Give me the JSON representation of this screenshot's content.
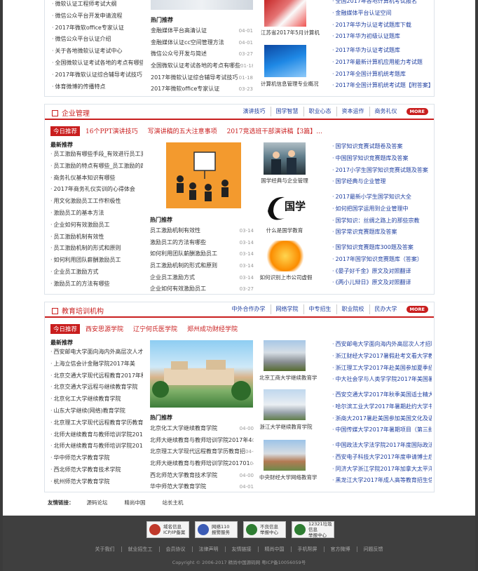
{
  "top": {
    "left_list": [
      "微软认证工程师考试大纲",
      "微信公众平台开发申请流程",
      "2017年微软office专家认证",
      "微信公众平台认证介绍",
      "关于各地微软认证考试中心",
      "全国微软认证考试各地的考点有哪些",
      "2017年微软认证综合辅导考试技巧",
      "体育微博的传播特点"
    ],
    "hot_title": "热门推荐",
    "hot": [
      [
        "金融媒体平台高清认证",
        "04-01"
      ],
      [
        "金融媒体认证cc空间管理方法",
        "04-01"
      ],
      [
        "微信公众号开发与简述",
        "03-27"
      ],
      [
        "全国微软认证考试各地的考点有哪些",
        "01-18"
      ],
      [
        "2017年微软认证综合辅导考试技巧",
        "01-18"
      ],
      [
        "2017年微软office专家认证",
        "03-23"
      ]
    ],
    "cap1": "江苏省2017年5月计算机",
    "cap2": "计算机信息管理专业概况",
    "right1": [
      "全国2017年各地计算机考试报名",
      "金融媒体平台认证空间",
      "2017年华为认证考试题库下载",
      "2017年华为初级认证题库"
    ],
    "right2": [
      "2017年华为认证考试题库",
      "2017年最新计算机应用能力考试题",
      "2017年全国计算机统考题库",
      "2017年全国计算机统考试题【附答案】"
    ]
  },
  "s1": {
    "name": "企业管理",
    "tabs": [
      "演讲技巧",
      "国学智慧",
      "职业心态",
      "资本运作",
      "商务礼仪"
    ],
    "more": "MORE",
    "today_tag": "今日推荐",
    "today": [
      "16个PPT演讲技巧",
      "写演讲稿的五大注意事项",
      "2017竞选班干部演讲稿【3篇】..."
    ],
    "new_title": "最新推荐",
    "list": [
      "员工激励有哪些手段_有效进行员工激",
      "员工激励的特点有哪些_员工激励的四",
      "商务礼仪基本知识有哪些",
      "2017年商务礼仪实训的心得体会",
      "用文化激励员工工作积极性",
      "激励员工的基本方法",
      "企业如何有效激励员工",
      "员工激励机制有效性",
      "员工激励机制的形式和原则",
      "如何利用团队薪酬激励员工",
      "企业员工激励方式",
      "激励员工的方法有哪些"
    ],
    "hot_title": "热门推荐",
    "hot": [
      [
        "员工激励机制有效性",
        "03-14"
      ],
      [
        "激励员工的方法有哪些",
        "03-14"
      ],
      [
        "如何利用团队薪酬激励员工",
        "03-14"
      ],
      [
        "员工激励机制的形式和原则",
        "03-14"
      ],
      [
        "企业员工激励方式",
        "03-14"
      ],
      [
        "企业如何有效激励员工",
        "03-27"
      ]
    ],
    "cap1": "国学经典与企业管理",
    "cap2": "什么是国学教育",
    "guoxue": "国学",
    "cap3": "如何识别上市公司虚假",
    "r1": [
      "国学知识竞赛试题卷及答案",
      "中国国学知识竞赛题库及答案",
      "2017小学生国学知识竞赛试题及答案",
      "国学经典与企业管理"
    ],
    "r2": [
      "2017最新小学生国学知识大全",
      "如何把国学运用到企业管理中",
      "国学知识：丝绸之路上的那些宗教",
      "国学常识竞赛题库及答案"
    ],
    "r3": [
      "国学知识竞赛题库300题及答案",
      "2017年国学知识竞赛题库（答案）",
      "《晏子好千金》原文及对照翻译",
      "《两小儿辩日》原文及对照翻译"
    ]
  },
  "s2": {
    "name": "教育培训机构",
    "tabs": [
      "中外合作办学",
      "网络学院",
      "中专招生",
      "职业院校",
      "民办大学"
    ],
    "more": "MORE",
    "today_tag": "今日推荐",
    "today": [
      "西安思源学院",
      "辽宁何氏医学院",
      "郑州成功财经学院"
    ],
    "new_title": "最新推荐",
    "list": [
      "西安邮电大学面向海内外高层次人才招",
      "上海立信会计金融学院2017年美",
      "北京交通大学现代远程教育2017年秋季",
      "北京交通大学远程与继续教育学院",
      "北京化工大学继续教育学院",
      "山东大学继续(网络)教育学院",
      "北京理工大学现代远程教育学历教育招",
      "北师大继续教育与教师培训学院201701",
      "北师大继续教育与教师培训学院2017年",
      "华中师范大学教育学院",
      "西北师范大学教育技术学院",
      "杭州师范大学教育学院"
    ],
    "hot_title": "热门推荐",
    "hot": [
      [
        "北京化工大学继续教育学院",
        "04-00"
      ],
      [
        "北师大继续教育与教师培训学院2017年4",
        "04-00"
      ],
      [
        "北京理工大学现代远程教育学历教育招",
        "04-00"
      ],
      [
        "北师大继续教育与教师培训学院201701",
        "04-00"
      ],
      [
        "西北师范大学教育技术学院",
        "04-00"
      ],
      [
        "华中师范大学教育学院",
        "04-01"
      ]
    ],
    "cap1": "北京工商大学继续教育学",
    "cap2": "浙江大学继续教育学院",
    "cap3": "中央财经大学网络教育学",
    "r1": [
      "西安邮电大学面向海内外高层次人才招聘",
      "浙江财经大学2017暑假赴考文看大学教",
      "浙江理工大学2017年赴美国参加夏季招",
      "中大社会学与人类学学院2017年美国暑期游"
    ],
    "r2": [
      "西安交通大学2017年秋季美国适士精大学",
      "哈尔滨工业大学2017年暑期赴约大学书",
      "浙商大2017暑赴美国参加美国文化及语言",
      "中国传媒大学2017年暑期项目（第三批）"
    ],
    "r3": [
      "中国政法大学法学院2017年度国际政法大",
      "西安电子科技大学2017年度申请博士后交",
      "同济大学浙江学院2017年加拿大太平洋",
      "黑龙江大学2017年成人高等教育招生信"
    ]
  },
  "friend": {
    "label": "友情链接：",
    "links": [
      "源码论坛",
      "精尚中国",
      "站长主机"
    ]
  },
  "footer": {
    "badges": [
      {
        "l1": "域名信息",
        "l2": "ICP/IP备案",
        "color": "#c0392b",
        "icon": "shield-icon"
      },
      {
        "l1": "网络110",
        "l2": "报警服务",
        "color": "#3b5bb5",
        "icon": "police-icon"
      },
      {
        "l1": "不良信息",
        "l2": "举报中心",
        "color": "#2e7d32",
        "icon": "report-icon"
      },
      {
        "l1": "12321垃圾信息",
        "l2": "举报中心",
        "color": "#2e7d32",
        "icon": "report-icon"
      }
    ],
    "links": [
      "关于我们",
      "就业招生工",
      "会员协议",
      "法律声明",
      "友情链接",
      "精尚中国",
      "手机帮屏",
      "官方微博",
      "问题反馈"
    ],
    "copyright": "Copyright © 2006-2017  精尚中国源码网 粤ICP备10056059号"
  }
}
